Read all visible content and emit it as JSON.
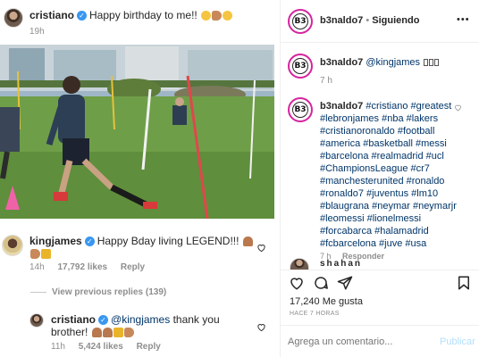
{
  "post": {
    "author": "cristiano",
    "caption": "Happy birthday to me!!",
    "time": "19h"
  },
  "comments": [
    {
      "user": "kingjames",
      "text": "Happy Bday living LEGEND!!!",
      "time": "14h",
      "likes": "17,792 likes",
      "reply": "Reply"
    },
    {
      "user": "cristiano",
      "mention": "@kingjames",
      "text": "thank you",
      "text2": "brother!",
      "time": "11h",
      "likes": "5,424 likes",
      "reply": "Reply"
    }
  ],
  "view_replies": "View previous replies (139)",
  "right_panel": {
    "header_user": "b3naldo7",
    "separator": "•",
    "follow_status": "Siguiendo",
    "more_label": "•••",
    "avatar_text": "B3",
    "first_comment_user": "b3naldo7",
    "first_comment_text": "@kingjames",
    "first_comment_time": "7 h",
    "second_comment_user": "b3naldo7",
    "hashtags_line1": "#cristiano #greatest",
    "hashtag_lines": [
      "#lebronjames #nba #lakers",
      "#cristianoronaldo #football",
      "#america #basketball #messi",
      "#barcelona #realmadrid #ucl",
      "#ChampionsLeague #cr7",
      "#manchesterunited #ronaldo",
      "#ronaldo7 #juventus #lm10",
      "#blaugrana #neymar #neymarjr",
      "#leomessi #lionelmessi",
      "#forcabarca #halamadrid",
      "#fcbarcelona #juve #usa"
    ],
    "second_comment_time": "7 h",
    "respond_label": "Responder",
    "partial_user": "shahan",
    "likes_count": "17,240 Me gusta",
    "post_age": "HACE 7 HORAS",
    "comment_placeholder": "Agrega un comentario...",
    "publish_label": "Publicar"
  },
  "icons": [
    "heart-icon",
    "comment-icon",
    "share-icon",
    "bookmark-icon",
    "more-icon",
    "verified-icon"
  ],
  "colors": {
    "link_blue": "#003569",
    "verified_blue": "#3897f0",
    "publish_disabled": "#b2dffc",
    "muted": "#8e8e8e",
    "grass": "#6a9a4a"
  }
}
